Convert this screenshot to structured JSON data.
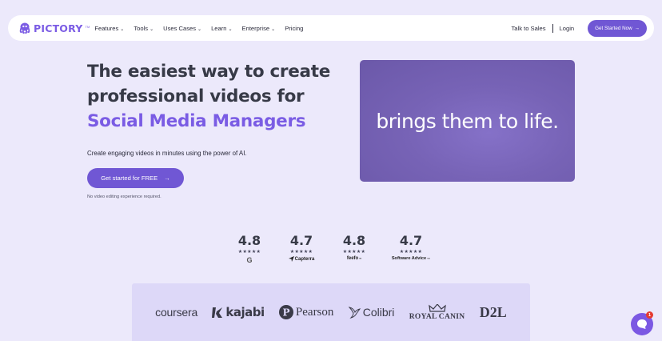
{
  "nav": {
    "brand": "PICTORY",
    "brand_tm": "TM",
    "menu": [
      {
        "label": "Features",
        "has_dropdown": true
      },
      {
        "label": "Tools",
        "has_dropdown": true
      },
      {
        "label": "Uses Cases",
        "has_dropdown": true
      },
      {
        "label": "Learn",
        "has_dropdown": true
      },
      {
        "label": "Enterprise",
        "has_dropdown": true
      },
      {
        "label": "Pricing",
        "has_dropdown": false
      }
    ],
    "talk_to_sales": "Talk to Sales",
    "login": "Login",
    "cta": "Get Started Now",
    "cta_arrow": "→",
    "dropdown_glyph": "⌄"
  },
  "hero": {
    "title_line1": "The easiest way to create",
    "title_line2": "professional videos for",
    "title_highlight": "Social Media Managers",
    "subtitle": "Create engaging videos in minutes using the power of AI.",
    "cta": "Get started for FREE",
    "cta_arrow": "→",
    "note": "No video editing experience required.",
    "video_caption": "brings them to life."
  },
  "ratings": [
    {
      "score": "4.8",
      "stars": "★★★★★",
      "platform": "G",
      "icon": "g2-logo-icon"
    },
    {
      "score": "4.7",
      "stars": "★★★★★",
      "platform": "Capterra",
      "icon": "capterra-logo-icon"
    },
    {
      "score": "4.8",
      "stars": "★★★★★",
      "platform": "feefo",
      "platform_suffix": "ºº",
      "icon": "feefo-logo-icon"
    },
    {
      "score": "4.7",
      "stars": "★★★★★",
      "platform": "Software Advice",
      "platform_suffix": "™",
      "icon": "software-advice-logo-icon"
    }
  ],
  "client_logos": [
    "coursera",
    "kajabi",
    "Pearson",
    "Colibri",
    "ROYAL CANIN",
    "D2L"
  ],
  "chat": {
    "badge": "1",
    "icon": "chat-bubble-icon"
  },
  "colors": {
    "accent": "#7057d4",
    "brand": "#7b5ce4",
    "background": "#ece9fb",
    "video": "#7763b6",
    "badge": "#e53b30"
  }
}
